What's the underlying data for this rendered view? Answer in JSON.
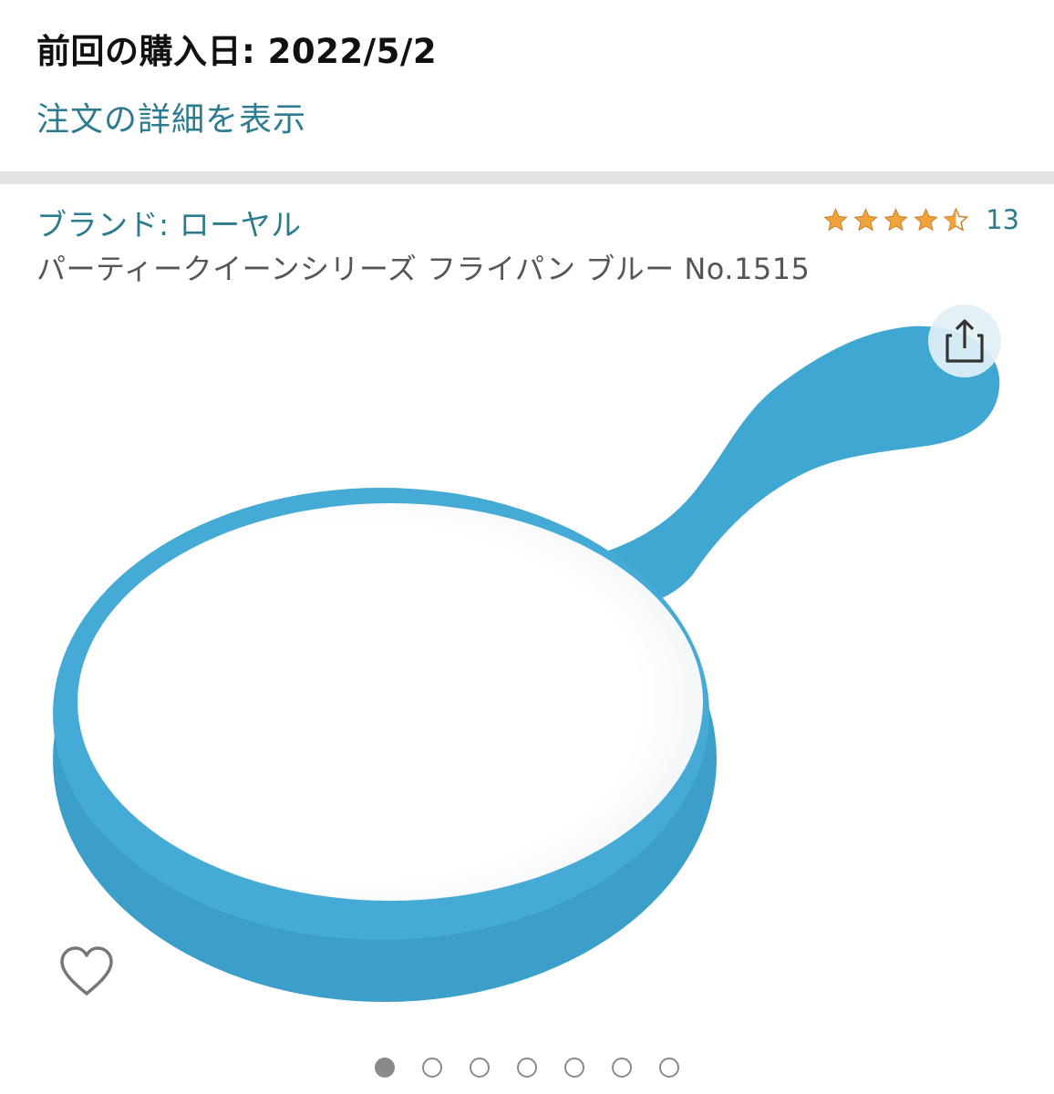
{
  "order": {
    "last_purchase": "前回の購入日: 2022/5/2",
    "details_link": "注文の詳細を表示"
  },
  "product": {
    "brand": "ブランド: ローヤル",
    "title": "パーティークイーンシリーズ フライパン ブルー No.1515",
    "rating_count": "13",
    "rating": 4.5,
    "rating_max": 5,
    "image_subject": "blue frying pan toy"
  },
  "gallery": {
    "total_images": 7,
    "active_index": 0
  },
  "colors": {
    "link": "#2d7b8e",
    "star": "#f0a33a",
    "pan": "#3fa7d2",
    "divider": "#e2e2e2"
  },
  "icons": {
    "share": "share-icon",
    "wishlist": "heart-icon"
  }
}
